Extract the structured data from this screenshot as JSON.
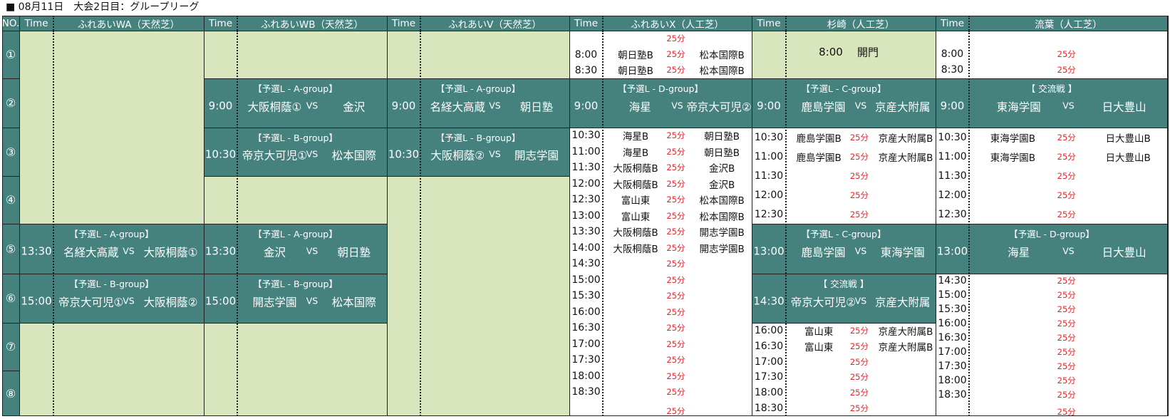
{
  "header_title": "■ 08月11日　大会2日目：グループリーグ",
  "header": {
    "no": "NO.",
    "time": "Time",
    "venues": [
      "ふれあいWA（天然芝）",
      "ふれあいWB（天然芝）",
      "ふれあいV（天然芝）",
      "ふれあいX（人工芝）",
      "杉崎（人工芝）",
      "流葉（人工芝）"
    ]
  },
  "slot_numbers": [
    "①",
    "②",
    "③",
    "④",
    "⑤",
    "⑥",
    "⑦",
    "⑧"
  ],
  "matches": [
    {
      "venue": 1,
      "row": 1,
      "group": "【予選L - A-group】",
      "time": "9:00",
      "team1": "大阪桐蔭①",
      "vs": "VS",
      "team2": "金沢"
    },
    {
      "venue": 1,
      "row": 2,
      "group": "【予選L - B-group】",
      "time": "10:30",
      "team1": "帝京大可児①",
      "vs": "VS",
      "team2": "松本国際"
    },
    {
      "venue": 2,
      "row": 1,
      "group": "【予選L - A-group】",
      "time": "9:00",
      "team1": "名経大高蔵",
      "vs": "VS",
      "team2": "朝日塾"
    },
    {
      "venue": 2,
      "row": 2,
      "group": "【予選L - B-group】",
      "time": "10:30",
      "team1": "大阪桐蔭②",
      "vs": "VS",
      "team2": "開志学園"
    },
    {
      "venue": 0,
      "row": 4,
      "group": "【予選L - A-group】",
      "time": "13:30",
      "team1": "名経大高蔵",
      "vs": "VS",
      "team2": "大阪桐蔭①"
    },
    {
      "venue": 0,
      "row": 5,
      "group": "【予選L - B-group】",
      "time": "15:00",
      "team1": "帝京大可児①",
      "vs": "VS",
      "team2": "大阪桐蔭②"
    },
    {
      "venue": 1,
      "row": 4,
      "group": "【予選L - A-group】",
      "time": "13:30",
      "team1": "金沢",
      "vs": "VS",
      "team2": "朝日塾"
    },
    {
      "venue": 1,
      "row": 5,
      "group": "【予選L - B-group】",
      "time": "15:00",
      "team1": "開志学園",
      "vs": "VS",
      "team2": "松本国際"
    },
    {
      "venue": 3,
      "row": 1,
      "group": "【予選L - D-group】",
      "time": "9:00",
      "team1": "海星",
      "vs": "VS",
      "team2": "帝京大可児②"
    },
    {
      "venue": 4,
      "row": 1,
      "group": "【予選L - C-group】",
      "time": "9:00",
      "team1": "鹿島学園",
      "vs": "VS",
      "team2": "京産大附属"
    },
    {
      "venue": 5,
      "row": 1,
      "group": "【 交流戦 】",
      "time": "9:00",
      "team1": "東海学園",
      "vs": "VS",
      "team2": "日大豊山"
    },
    {
      "venue": 4,
      "row": 4,
      "group": "【予選L - C-group】",
      "time": "13:00",
      "team1": "鹿島学園",
      "vs": "VS",
      "team2": "東海学園"
    },
    {
      "venue": 5,
      "row": 4,
      "group": "【予選L - D-group】",
      "time": "13:00",
      "team1": "海星",
      "vs": "VS",
      "team2": "日大豊山"
    },
    {
      "venue": 4,
      "row": 5,
      "group": "【 交流戦 】",
      "time": "14:30",
      "team1": "帝京大可児②",
      "vs": "VS",
      "team2": "京産大附属"
    }
  ],
  "suzaki_open": {
    "time": "8:00",
    "label": "開門"
  },
  "ranking_dur": "25分",
  "fureai_x_early": [
    {
      "time": "",
      "team1": "",
      "team2": ""
    },
    {
      "time": "8:00",
      "team1": "朝日塾B",
      "team2": "松本国際B"
    },
    {
      "time": "8:30",
      "team1": "朝日塾B",
      "team2": "松本国際B"
    }
  ],
  "fureai_x_late": [
    {
      "time": "10:30",
      "team1": "海星B",
      "team2": "朝日塾B"
    },
    {
      "time": "11:00",
      "team1": "海星B",
      "team2": "朝日塾B"
    },
    {
      "time": "11:30",
      "team1": "大阪桐蔭B",
      "team2": "金沢B"
    },
    {
      "time": "12:00",
      "team1": "大阪桐蔭B",
      "team2": "金沢B"
    },
    {
      "time": "12:30",
      "team1": "富山東",
      "team2": "松本国際B"
    },
    {
      "time": "13:00",
      "team1": "富山東",
      "team2": "松本国際B"
    },
    {
      "time": "13:30",
      "team1": "大阪桐蔭B",
      "team2": "開志学園B"
    },
    {
      "time": "14:00",
      "team1": "大阪桐蔭B",
      "team2": "開志学園B"
    },
    {
      "time": "14:30",
      "team1": "",
      "team2": ""
    },
    {
      "time": "15:00",
      "team1": "",
      "team2": ""
    },
    {
      "time": "15:30",
      "team1": "",
      "team2": ""
    },
    {
      "time": "16:00",
      "team1": "",
      "team2": ""
    },
    {
      "time": "16:30",
      "team1": "",
      "team2": ""
    },
    {
      "time": "17:00",
      "team1": "",
      "team2": ""
    },
    {
      "time": "17:30",
      "team1": "",
      "team2": ""
    },
    {
      "time": "18:00",
      "team1": "",
      "team2": ""
    },
    {
      "time": "18:30",
      "team1": "",
      "team2": ""
    },
    {
      "time": "",
      "team1": "",
      "team2": ""
    }
  ],
  "suzaki_mid": [
    {
      "time": "10:30",
      "team1": "鹿島学園B",
      "team2": "京産大附属B"
    },
    {
      "time": "11:00",
      "team1": "鹿島学園B",
      "team2": "京産大附属B"
    },
    {
      "time": "11:30",
      "team1": "",
      "team2": ""
    },
    {
      "time": "12:00",
      "team1": "",
      "team2": ""
    },
    {
      "time": "12:30",
      "team1": "",
      "team2": ""
    }
  ],
  "suzaki_late": [
    {
      "time": "16:00",
      "team1": "富山東",
      "team2": "京産大附属B"
    },
    {
      "time": "16:30",
      "team1": "富山東",
      "team2": "京産大附属B"
    },
    {
      "time": "17:00",
      "team1": "",
      "team2": ""
    },
    {
      "time": "17:30",
      "team1": "",
      "team2": ""
    },
    {
      "time": "18:00",
      "team1": "",
      "team2": ""
    },
    {
      "time": "18:30",
      "team1": "",
      "team2": ""
    }
  ],
  "ryuba_early": [
    {
      "time": "8:00",
      "team1": "",
      "team2": ""
    },
    {
      "time": "8:30",
      "team1": "",
      "team2": ""
    }
  ],
  "ryuba_mid": [
    {
      "time": "10:30",
      "team1": "東海学園B",
      "team2": "日大豊山B"
    },
    {
      "time": "11:00",
      "team1": "東海学園B",
      "team2": "日大豊山B"
    },
    {
      "time": "11:30",
      "team1": "",
      "team2": ""
    },
    {
      "time": "12:00",
      "team1": "",
      "team2": ""
    },
    {
      "time": "12:30",
      "team1": "",
      "team2": ""
    }
  ],
  "ryuba_late": [
    {
      "time": "14:30",
      "team1": "",
      "team2": ""
    },
    {
      "time": "15:00",
      "team1": "",
      "team2": ""
    },
    {
      "time": "15:30",
      "team1": "",
      "team2": ""
    },
    {
      "time": "16:00",
      "team1": "",
      "team2": ""
    },
    {
      "time": "16:30",
      "team1": "",
      "team2": ""
    },
    {
      "time": "17:00",
      "team1": "",
      "team2": ""
    },
    {
      "time": "17:30",
      "team1": "",
      "team2": ""
    },
    {
      "time": "18:00",
      "team1": "",
      "team2": ""
    },
    {
      "time": "18:30",
      "team1": "",
      "team2": ""
    },
    {
      "time": "",
      "team1": "",
      "team2": ""
    }
  ]
}
